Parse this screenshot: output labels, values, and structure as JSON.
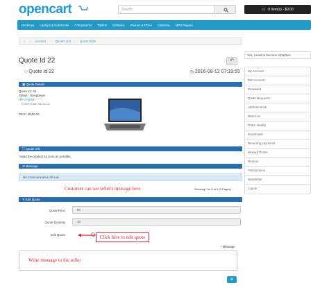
{
  "header": {
    "logo": "opencart",
    "search_placeholder": "Search",
    "cart_label": "0 item(s) - $0.00"
  },
  "nav": [
    "Desktops",
    "Laptops & Notebooks",
    "Components",
    "Tablets",
    "Software",
    "Phones & PDAs",
    "Cameras",
    "MP3 Players"
  ],
  "breadcrumb": [
    "Account",
    "Quotes List",
    "Quote Id 22"
  ],
  "page": {
    "title": "Quote Id 22",
    "subtitle": "Quote Id 22",
    "date": "2016-08-12 07:19:55"
  },
  "quote_details": {
    "heading": "Quote Details",
    "id_line": "Quote Id : 22",
    "status_line": "Status : UnApprove",
    "product": "HP LP3065",
    "delivery": "- Delivery Date 2011-04-22",
    "price": "Price : $100.00"
  },
  "quote_info": {
    "heading": "Quote Info",
    "text": "I want the product as soon as possible."
  },
  "message": {
    "heading": "Message",
    "empty": "No Communication till now",
    "annotation": "Customer can see seller's message here",
    "pagination": "Showing 0 to 0 of 0 (0 Pages)"
  },
  "edit_quote": {
    "heading": "Edit Quote",
    "price_label": "Quote Price",
    "price_value": "80",
    "qty_label": "Quote Quantity",
    "qty_value": "10",
    "edit_label": "Edit Quote",
    "callout": "Click here to edit quote",
    "message_label": "* Message",
    "textarea_annotation": "Write message to the seller"
  },
  "sidebar": {
    "top": "Yes, I want to become a Partner..",
    "items": [
      "My Account",
      "Edit Account",
      "Password",
      "Quote Requests",
      "Address Book",
      "Wish List",
      "Order History",
      "Downloads",
      "Recurring payments",
      "Reward Points",
      "Returns",
      "Transactions",
      "Newsletter",
      "Logout"
    ]
  },
  "colors": {
    "brand": "#239cd3",
    "nav": "#229ac8",
    "panel": "#2a6ead",
    "annotation": "#e8262b"
  }
}
